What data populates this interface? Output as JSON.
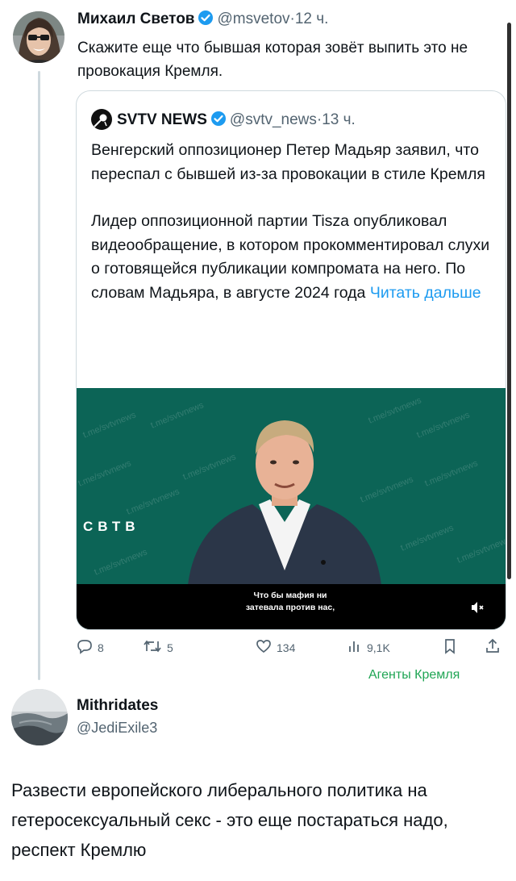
{
  "tweet": {
    "author_name": "Михаил Светов",
    "handle": "@msvetov",
    "separator": "·",
    "time": "12 ч.",
    "text": "Скажите еще что бывшая которая зовёт выпить это не провокация Кремля."
  },
  "quote": {
    "author_name": "SVTV NEWS",
    "handle": "@svtv_news",
    "separator": "·",
    "time": "13 ч.",
    "paragraph1": "Венгерский оппозиционер Петер Мадьяр заявил, что переспал с бывшей из-за провокации в стиле Кремля",
    "paragraph2": "Лидер оппозиционной партии Tisza опубликовал видеообращение, в котором прокомментировал слухи о готовящейся публикации компромата на него. По словам Мадьяра, в августе 2024 года",
    "read_more": "Читать дальше",
    "media": {
      "watermark": "t.me/svtvnews",
      "logo_text": "СВТВ",
      "subtitle_line1": "Что бы мафия ни",
      "subtitle_line2": "затевала против нас,"
    }
  },
  "actions": {
    "replies": "8",
    "retweets": "5",
    "likes": "134",
    "views": "9,1K"
  },
  "caption": "Агенты Кремля",
  "reply": {
    "author_name": "Mithridates",
    "handle": "@JediExile3",
    "text": "Развести европейского либерального политика на гетеросексуальный секс - это еще постараться надо, респект Кремлю"
  },
  "colors": {
    "accent": "#1d9bf0",
    "caption": "#1fa554",
    "media_bg": "#0c6456",
    "secondary_text": "#536471"
  }
}
